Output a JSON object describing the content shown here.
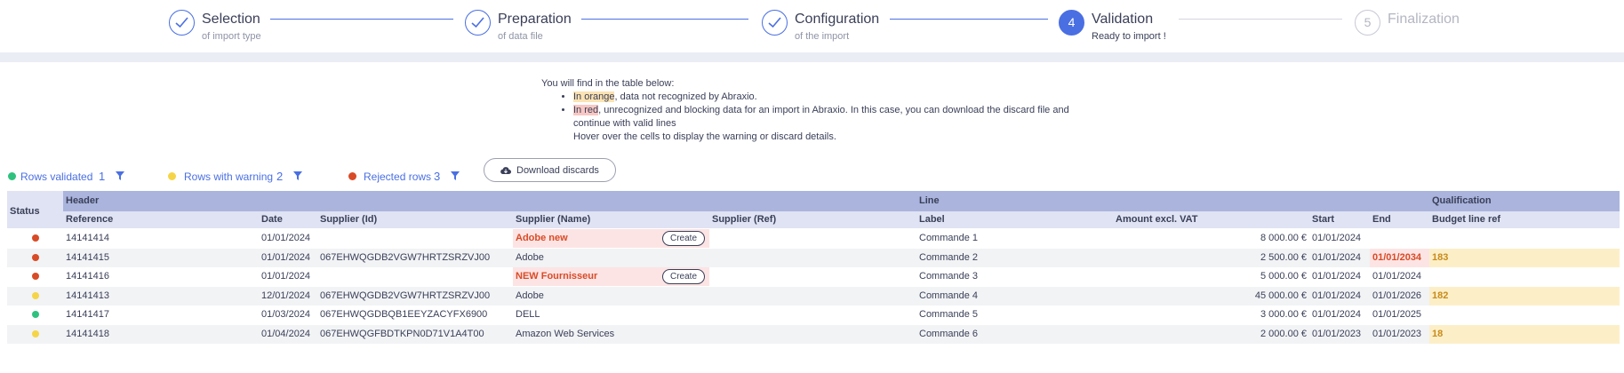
{
  "stepper": {
    "steps": [
      {
        "title": "Selection",
        "subtitle": "of import type",
        "state": "done"
      },
      {
        "title": "Preparation",
        "subtitle": "of data file",
        "state": "done"
      },
      {
        "title": "Configuration",
        "subtitle": "of the import",
        "state": "done"
      },
      {
        "number": "4",
        "title": "Validation",
        "subtitle": "Ready to import !",
        "state": "active"
      },
      {
        "number": "5",
        "title": "Finalization",
        "subtitle": "",
        "state": "pending"
      }
    ]
  },
  "info": {
    "intro": "You will find in the table below:",
    "orange_hl": "In orange",
    "orange_text": ", data not recognized by Abraxio.",
    "red_hl": "In red",
    "red_text_1": ", unrecognized and blocking data for an import in Abraxio. In this case, you can download the discard file and",
    "red_text_2": "continue with valid lines",
    "hover": "Hover over the cells to display the warning or discard details."
  },
  "filters": [
    {
      "label": "Rows validated",
      "count": "1",
      "color": "#2ec27e"
    },
    {
      "label": "Rows with warning",
      "count": "2",
      "color": "#f5d547"
    },
    {
      "label": "Rejected rows",
      "count": "3",
      "color": "#d84b26"
    }
  ],
  "download_label": "Download discards",
  "table": {
    "status_header": "Status",
    "groups": {
      "header": "Header",
      "line": "Line",
      "qualification": "Qualification"
    },
    "columns": {
      "reference": "Reference",
      "date": "Date",
      "supplier_id": "Supplier (Id)",
      "supplier_name": "Supplier (Name)",
      "supplier_ref": "Supplier (Ref)",
      "label": "Label",
      "amount": "Amount excl. VAT",
      "start": "Start",
      "end": "End",
      "budget": "Budget line ref"
    },
    "create_label": "Create",
    "rows": [
      {
        "status": "rejected",
        "reference": "14141414",
        "date": "01/01/2024",
        "supplier_id": "",
        "supplier_name": "Adobe new",
        "supplier_ref": "",
        "label": "Commande 1",
        "amount": "8 000.00 €",
        "start": "01/01/2024",
        "end": "",
        "budget": ""
      },
      {
        "status": "rejected",
        "reference": "14141415",
        "date": "01/01/2024",
        "supplier_id": "067EHWQGDB2VGW7HRTZSRZVJ00",
        "supplier_name": "Adobe",
        "supplier_ref": "",
        "label": "Commande 2",
        "amount": "2 500.00 €",
        "start": "01/01/2024",
        "end": "01/01/2034",
        "budget": "183"
      },
      {
        "status": "rejected",
        "reference": "14141416",
        "date": "01/01/2024",
        "supplier_id": "",
        "supplier_name": "NEW Fournisseur",
        "supplier_ref": "",
        "label": "Commande 3",
        "amount": "5 000.00 €",
        "start": "01/01/2024",
        "end": "01/01/2024",
        "budget": ""
      },
      {
        "status": "warning",
        "reference": "14141413",
        "date": "12/01/2024",
        "supplier_id": "067EHWQGDB2VGW7HRTZSRZVJ00",
        "supplier_name": "Adobe",
        "supplier_ref": "",
        "label": "Commande 4",
        "amount": "45 000.00 €",
        "start": "01/01/2024",
        "end": "01/01/2026",
        "budget": "182"
      },
      {
        "status": "validated",
        "reference": "14141417",
        "date": "01/03/2024",
        "supplier_id": "067EHWQGDBQB1EEYZACYFX6900",
        "supplier_name": "DELL",
        "supplier_ref": "",
        "label": "Commande 5",
        "amount": "3 000.00 €",
        "start": "01/01/2024",
        "end": "01/01/2025",
        "budget": ""
      },
      {
        "status": "warning",
        "reference": "14141418",
        "date": "01/04/2024",
        "supplier_id": "067EHWQGFBDTKPN0D71V1A4T00",
        "supplier_name": "Amazon Web Services",
        "supplier_ref": "",
        "label": "Commande 6",
        "amount": "2 000.00 €",
        "start": "01/01/2023",
        "end": "01/01/2023",
        "budget": "18"
      }
    ]
  },
  "colors": {
    "accent": "#4a6fe3",
    "validated": "#2ec27e",
    "warning": "#f5d547",
    "rejected": "#d84b26"
  }
}
